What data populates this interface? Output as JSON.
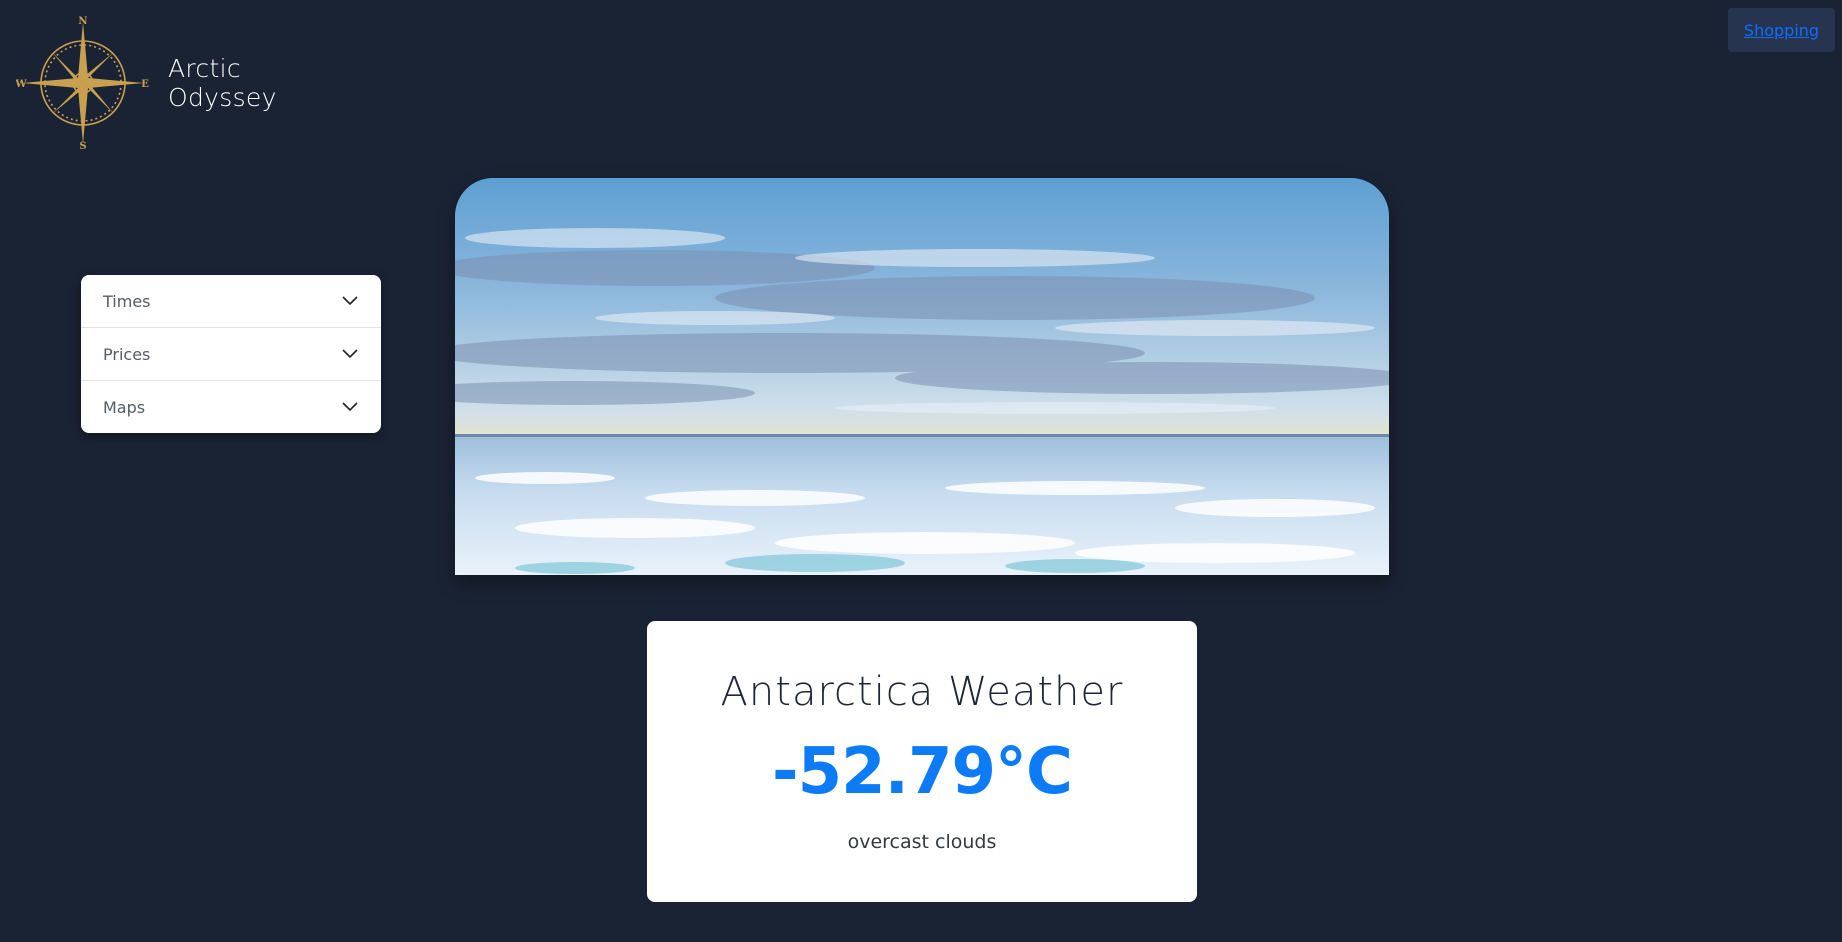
{
  "brand": {
    "line1": "Arctic",
    "line2": "Odyssey",
    "compass_letters": {
      "n": "N",
      "s": "S",
      "e": "E",
      "w": "W"
    },
    "logo_color": "#c9a04f"
  },
  "nav": {
    "shopping_label": "Shopping"
  },
  "accordion": {
    "items": [
      {
        "label": "Times"
      },
      {
        "label": "Prices"
      },
      {
        "label": "Maps"
      }
    ]
  },
  "weather": {
    "title": "Antarctica Weather",
    "temperature": "-52.79°C",
    "description": "overcast clouds",
    "accent_color": "#0d7bf5"
  },
  "colors": {
    "background": "#1a2334",
    "card": "#ffffff"
  }
}
